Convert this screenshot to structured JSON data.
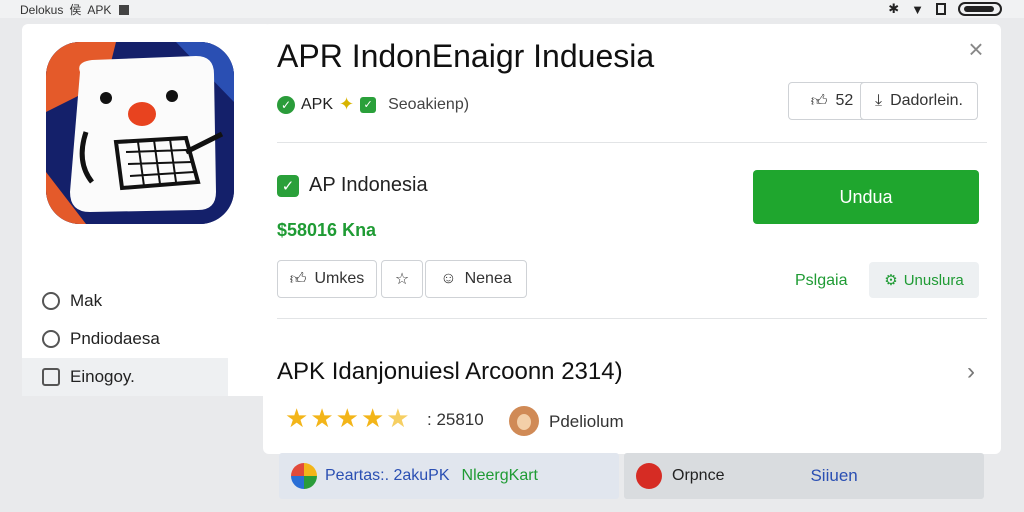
{
  "statusbar": {
    "left_text_1": "Delokus",
    "left_text_2": "侯",
    "left_text_3": "APK"
  },
  "left_panel": {
    "app_icon": "cartoon-face-icon",
    "menu": [
      {
        "label": "Mak",
        "icon": "circle-slash-icon"
      },
      {
        "label": "Pndiodaesa",
        "icon": "circle-slash-icon"
      },
      {
        "label": "Einogoy.",
        "icon": "edit-icon"
      }
    ]
  },
  "main": {
    "title": "APR IndonEnaigr Induesia",
    "sub_label": "APK",
    "sub_muted": "Seoakienp)",
    "like_count": "52",
    "download_label": "Dadorlein.",
    "info_title": "AP Indonesia",
    "price": "$58016 Kna",
    "install_label": "Undua",
    "likes_label": "Umkes",
    "nenea_label": "Nenea",
    "green_label": "Pslgaia",
    "unuslura_label": "Unuslura",
    "review_title": "APK Idanjonuiesl Arcoonn 2314)",
    "rating": 4.5,
    "rating_count": ": 25810",
    "reviewer": "Pdeliolum"
  },
  "bottom": {
    "left_blue": "Peartas:. 2akuPK",
    "left_green": "NleergKart",
    "right_text": "Orpnce",
    "right_link": "Siiuen"
  },
  "colors": {
    "accent_green": "#1fa62e",
    "star": "#f3b519",
    "link_blue": "#2a4fb3"
  }
}
